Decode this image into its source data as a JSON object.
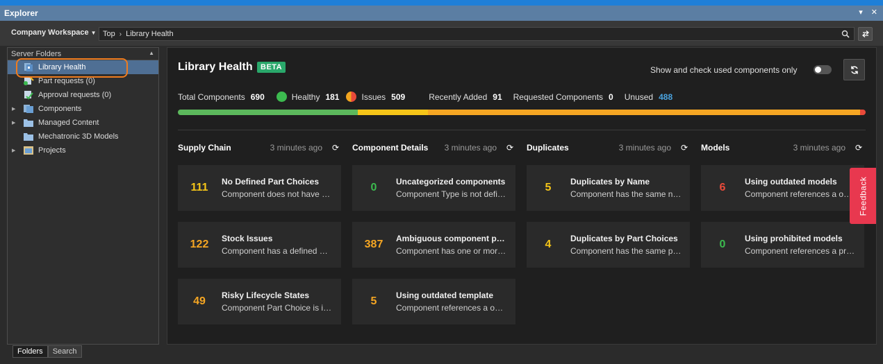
{
  "window": {
    "title": "Explorer",
    "controls": [
      "▾",
      "✕"
    ]
  },
  "toolbar": {
    "workspace": "Company Workspace",
    "path": [
      "Top",
      "Library Health"
    ]
  },
  "left_panel": {
    "header": "Server Folders",
    "items": [
      {
        "label": "Library Health",
        "icon": "library-health-icon",
        "selected": true,
        "expandable": false
      },
      {
        "label": "Part requests (0)",
        "icon": "part-request-icon",
        "selected": false,
        "expandable": false
      },
      {
        "label": "Approval requests (0)",
        "icon": "approval-request-icon",
        "selected": false,
        "expandable": false
      },
      {
        "label": "Components",
        "icon": "components-icon",
        "selected": false,
        "expandable": true
      },
      {
        "label": "Managed Content",
        "icon": "folder-icon",
        "selected": false,
        "expandable": true
      },
      {
        "label": "Mechatronic 3D Models",
        "icon": "folder-icon",
        "selected": false,
        "expandable": false
      },
      {
        "label": "Projects",
        "icon": "projects-icon",
        "selected": false,
        "expandable": true
      }
    ],
    "tabs": [
      "Folders",
      "Search"
    ]
  },
  "main": {
    "title": "Library Health",
    "badge": "BETA",
    "toggle_label": "Show and check used components only",
    "toggle_on": false,
    "stats": {
      "total_label": "Total Components",
      "total": "690",
      "healthy_label": "Healthy",
      "healthy": "181",
      "issues_label": "Issues",
      "issues": "509",
      "recent_label": "Recently Added",
      "recent": "91",
      "requested_label": "Requested Components",
      "requested": "0",
      "unused_label": "Unused",
      "unused": "488"
    },
    "health_bar": [
      {
        "label": "healthy",
        "fraction": 0.262,
        "color": "#5cb85c"
      },
      {
        "label": "warning",
        "fraction": 0.102,
        "color": "#f5c518"
      },
      {
        "label": "issues",
        "fraction": 0.628,
        "color": "#f5a623"
      },
      {
        "label": "critical",
        "fraction": 0.008,
        "color": "#e94a3a"
      }
    ],
    "sections": [
      {
        "name": "Supply Chain",
        "time": "3 minutes ago",
        "cards": [
          {
            "value": "111",
            "color": "yellow",
            "title": "No Defined Part Choices",
            "desc": "Component does not have any Part Choices"
          },
          {
            "value": "122",
            "color": "orange",
            "title": "Stock Issues",
            "desc": "Component has a defined Part Choice with stock issues"
          },
          {
            "value": "49",
            "color": "orange",
            "title": "Risky Lifecycle States",
            "desc": "Component Part Choice is in a risky lifecycle state"
          }
        ]
      },
      {
        "name": "Component Details",
        "time": "3 minutes ago",
        "cards": [
          {
            "value": "0",
            "color": "green",
            "title": "Uncategorized components",
            "desc": "Component Type is not defined"
          },
          {
            "value": "387",
            "color": "orange",
            "title": "Ambiguous component parameters",
            "desc": "Component has one or more ambiguous parameters"
          },
          {
            "value": "5",
            "color": "orange",
            "title": "Using outdated template",
            "desc": "Component references a outdated template"
          }
        ]
      },
      {
        "name": "Duplicates",
        "time": "3 minutes ago",
        "cards": [
          {
            "value": "5",
            "color": "yellow",
            "title": "Duplicates by Name",
            "desc": "Component has the same name as another"
          },
          {
            "value": "4",
            "color": "yellow",
            "title": "Duplicates by Part Choices",
            "desc": "Component has the same part choices as another"
          }
        ]
      },
      {
        "name": "Models",
        "time": "3 minutes ago",
        "cards": [
          {
            "value": "6",
            "color": "red",
            "title": "Using outdated models",
            "desc": "Component references a outdated model"
          },
          {
            "value": "0",
            "color": "green",
            "title": "Using prohibited models",
            "desc": "Component references a prohibited model"
          }
        ]
      }
    ],
    "feedback": "Feedback"
  },
  "colors": {
    "accent": "#2aa86b",
    "selected": "#4f6f94",
    "highlight_ring": "#f07c1e",
    "feedback": "#e8384f"
  }
}
